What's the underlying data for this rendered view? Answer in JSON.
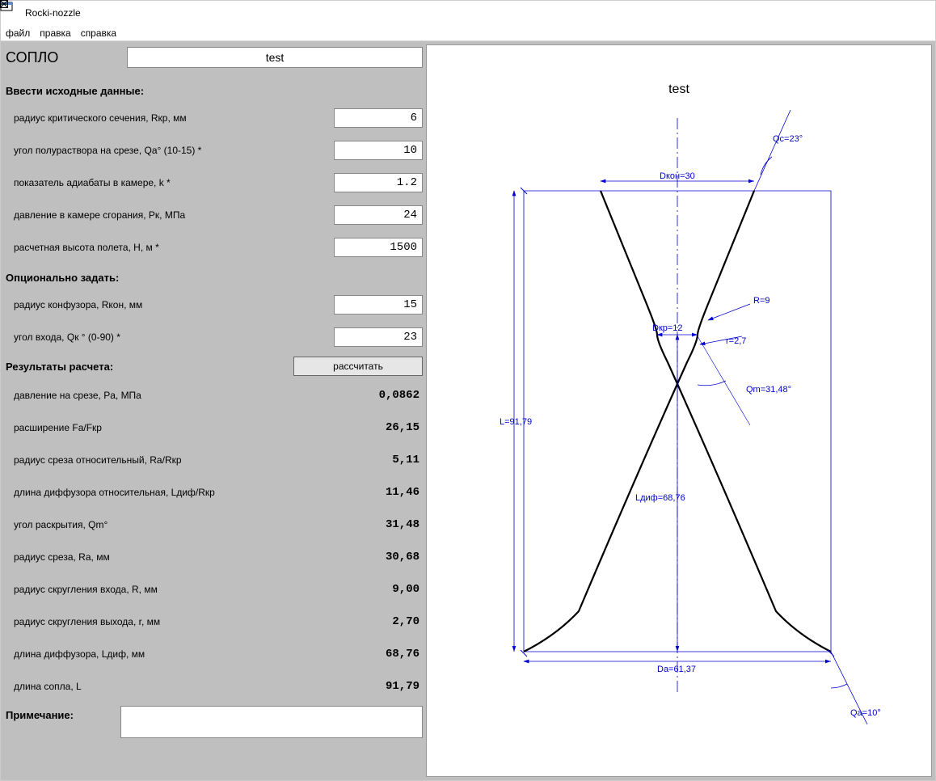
{
  "window": {
    "title": "Rocki-nozzle"
  },
  "menu": {
    "file": "файл",
    "edit": "правка",
    "help": "справка"
  },
  "heading": {
    "label": "СОПЛО",
    "name_value": "test"
  },
  "sections": {
    "input_title": "Ввести исходные данные:",
    "optional_title": "Опционально задать:",
    "results_title": "Результаты расчета:",
    "note_title": "Примечание:"
  },
  "inputs": {
    "rkr": {
      "label": "радиус критического сечения, Rкр, мм",
      "value": "6"
    },
    "qa": {
      "label": "угол полураствора на срезе, Qа° (10-15) *",
      "value": "10"
    },
    "k": {
      "label": "показатель адиабаты в камере, k *",
      "value": "1.2"
    },
    "pk": {
      "label": "давление в камере сгорания, Pк, МПа",
      "value": "24"
    },
    "h": {
      "label": "расчетная высота полета, H, м *",
      "value": "1500"
    },
    "rkon": {
      "label": "радиус конфузора, Rкон, мм",
      "value": "15"
    },
    "qk": {
      "label": "угол входа, Qк ° (0-90) *",
      "value": "23"
    }
  },
  "calc_button": "рассчитать",
  "results": {
    "pa": {
      "label": "давление на срезе, Pa, МПа",
      "value": "0,0862"
    },
    "fa": {
      "label": "расширение Fa/Fкр",
      "value": "26,15"
    },
    "ra_rel": {
      "label": "радиус среза относительный, Ra/Rкр",
      "value": "5,11"
    },
    "ldif_rel": {
      "label": "длина диффузора относительная, Lдиф/Rкр",
      "value": "11,46"
    },
    "qm": {
      "label": "угол раскрытия, Qm°",
      "value": "31,48"
    },
    "ra": {
      "label": "радиус среза, Ra, мм",
      "value": "30,68"
    },
    "r_big": {
      "label": "радиус скругления входа, R, мм",
      "value": "9,00"
    },
    "r_small": {
      "label": "радиус скругления выхода, r, мм",
      "value": "2,70"
    },
    "ldif": {
      "label": "длина диффузора, Lдиф, мм",
      "value": "68,76"
    },
    "l": {
      "label": "длина сопла, L",
      "value": "91,79"
    }
  },
  "note_value": "",
  "diagram": {
    "title": "test",
    "qc": "Qc=23°",
    "dkon": "Dкон=30",
    "dkr": "Dкр=12",
    "r_big": "R=9",
    "r_small": "r=2,7",
    "qm": "Qm=31,48°",
    "l": "L=91,79",
    "ldif": "Lдиф=68,76",
    "da": "Da=61,37",
    "qa": "Qa=10°"
  }
}
